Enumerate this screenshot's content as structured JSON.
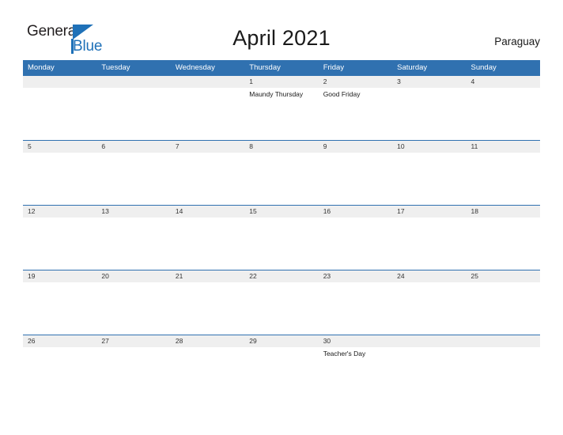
{
  "brand": {
    "name_part1": "General",
    "name_part2": "Blue",
    "accent_color": "#1f71b8",
    "triangle_icon": "blue-triangle-flag-icon"
  },
  "header": {
    "title": "April 2021",
    "country": "Paraguay"
  },
  "colors": {
    "header_blue": "#3071b0",
    "day_band_gray": "#efefef",
    "week_divider_blue": "#3071b0",
    "text_dark": "#1a1a1a"
  },
  "calendar": {
    "weekdays": [
      "Monday",
      "Tuesday",
      "Wednesday",
      "Thursday",
      "Friday",
      "Saturday",
      "Sunday"
    ],
    "weeks": [
      {
        "days": [
          {
            "date": "",
            "event": ""
          },
          {
            "date": "",
            "event": ""
          },
          {
            "date": "",
            "event": ""
          },
          {
            "date": "1",
            "event": "Maundy Thursday"
          },
          {
            "date": "2",
            "event": "Good Friday"
          },
          {
            "date": "3",
            "event": ""
          },
          {
            "date": "4",
            "event": ""
          }
        ]
      },
      {
        "days": [
          {
            "date": "5",
            "event": ""
          },
          {
            "date": "6",
            "event": ""
          },
          {
            "date": "7",
            "event": ""
          },
          {
            "date": "8",
            "event": ""
          },
          {
            "date": "9",
            "event": ""
          },
          {
            "date": "10",
            "event": ""
          },
          {
            "date": "11",
            "event": ""
          }
        ]
      },
      {
        "days": [
          {
            "date": "12",
            "event": ""
          },
          {
            "date": "13",
            "event": ""
          },
          {
            "date": "14",
            "event": ""
          },
          {
            "date": "15",
            "event": ""
          },
          {
            "date": "16",
            "event": ""
          },
          {
            "date": "17",
            "event": ""
          },
          {
            "date": "18",
            "event": ""
          }
        ]
      },
      {
        "days": [
          {
            "date": "19",
            "event": ""
          },
          {
            "date": "20",
            "event": ""
          },
          {
            "date": "21",
            "event": ""
          },
          {
            "date": "22",
            "event": ""
          },
          {
            "date": "23",
            "event": ""
          },
          {
            "date": "24",
            "event": ""
          },
          {
            "date": "25",
            "event": ""
          }
        ]
      },
      {
        "days": [
          {
            "date": "26",
            "event": ""
          },
          {
            "date": "27",
            "event": ""
          },
          {
            "date": "28",
            "event": ""
          },
          {
            "date": "29",
            "event": ""
          },
          {
            "date": "30",
            "event": "Teacher's Day"
          },
          {
            "date": "",
            "event": ""
          },
          {
            "date": "",
            "event": ""
          }
        ]
      }
    ]
  }
}
